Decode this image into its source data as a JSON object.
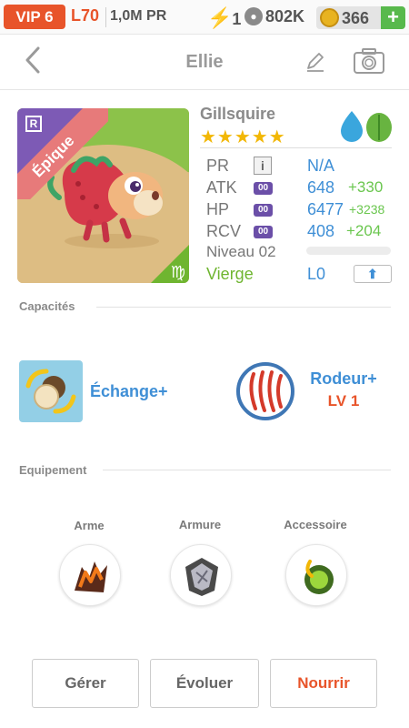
{
  "status_bar": {
    "vip": "VIP 6",
    "level": "L70",
    "pr": "1,0M PR",
    "energy": "1",
    "paws": "802K",
    "coins": "366",
    "plus": "+"
  },
  "header": {
    "back": "<",
    "title": "Ellie"
  },
  "pet": {
    "name": "Gillsquire",
    "stars": "★★★★★",
    "rarity": "Épique",
    "rarity_badge": "R",
    "stats": {
      "pr_label": "PR",
      "pr_info": "i",
      "pr_value": "N/A",
      "atk_label": "ATK",
      "atk_tag": "00",
      "atk_value": "648",
      "atk_bonus": "+330",
      "hp_label": "HP",
      "hp_tag": "00",
      "hp_value": "6477",
      "hp_bonus": "+3238",
      "rcv_label": "RCV",
      "rcv_tag": "00",
      "rcv_value": "408",
      "rcv_bonus": "+204"
    },
    "level_label": "Niveau 02",
    "xp_progress": 0,
    "zodiac": "Vierge",
    "l_value": "L0",
    "element_colors": {
      "water": "#3aa6dd",
      "leaf": "#68b440"
    }
  },
  "abilities": {
    "section_title": "Capacités",
    "ability1": "Échange+",
    "ability2": "Rodeur+",
    "ability2_level": "LV 1"
  },
  "equipment": {
    "section_title": "Equipement",
    "weapon": "Arme",
    "armor": "Armure",
    "accessory": "Accessoire"
  },
  "actions": {
    "manage": "Gérer",
    "evolve": "Évoluer",
    "feed": "Nourrir"
  },
  "colors": {
    "accent_orange": "#e8542a",
    "blue": "#3f8fd6",
    "green": "#6ac64e",
    "purple": "#6b4fa8"
  }
}
